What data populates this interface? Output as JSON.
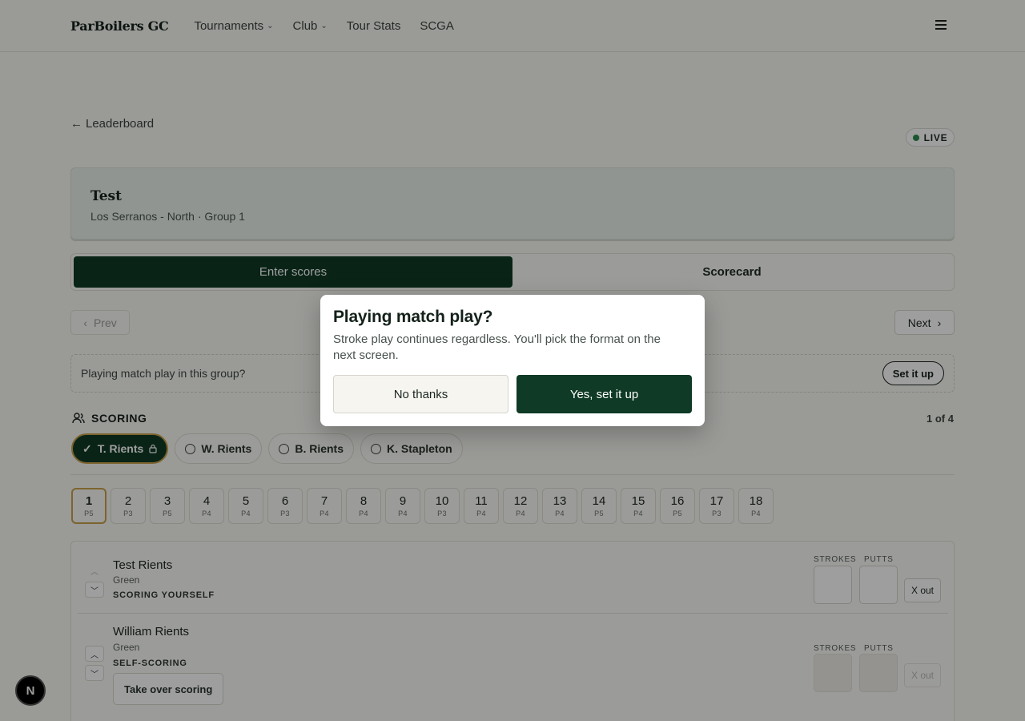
{
  "nav": {
    "brand": "ParBoilers GC",
    "links": [
      {
        "label": "Tournaments",
        "icon": "chevron-down-icon"
      },
      {
        "label": "Club",
        "icon": "chevron-down-icon"
      },
      {
        "label": "Tour Stats"
      },
      {
        "label": "SCGA"
      }
    ],
    "menu_icon": "hamburger-icon"
  },
  "back": {
    "label": "Leaderboard",
    "icon": "arrow-left-icon"
  },
  "live": {
    "label": "LIVE",
    "color": "#2b8c4f"
  },
  "event": {
    "title": "Test",
    "subtitle": "Los Serranos - North · Group 1"
  },
  "tabs": [
    {
      "label": "Enter scores",
      "active": true
    },
    {
      "label": "Scorecard",
      "active": false
    }
  ],
  "pager": {
    "prev": "Prev",
    "next": "Next"
  },
  "match_banner": {
    "text": "Playing match play in this group?",
    "button": "Set it up"
  },
  "scoring": {
    "title": "SCORING",
    "count": "1 of 4",
    "players": [
      {
        "label": "T. Rients",
        "active": true,
        "locked": true
      },
      {
        "label": "W. Rients",
        "active": false
      },
      {
        "label": "B. Rients",
        "active": false
      },
      {
        "label": "K. Stapleton",
        "active": false
      }
    ]
  },
  "holes": [
    {
      "num": "1",
      "par": "P5"
    },
    {
      "num": "2",
      "par": "P3"
    },
    {
      "num": "3",
      "par": "P5"
    },
    {
      "num": "4",
      "par": "P4"
    },
    {
      "num": "5",
      "par": "P4"
    },
    {
      "num": "6",
      "par": "P3"
    },
    {
      "num": "7",
      "par": "P4"
    },
    {
      "num": "8",
      "par": "P4"
    },
    {
      "num": "9",
      "par": "P4"
    },
    {
      "num": "10",
      "par": "P3"
    },
    {
      "num": "11",
      "par": "P4"
    },
    {
      "num": "12",
      "par": "P4"
    },
    {
      "num": "13",
      "par": "P4"
    },
    {
      "num": "14",
      "par": "P5"
    },
    {
      "num": "15",
      "par": "P4"
    },
    {
      "num": "16",
      "par": "P5"
    },
    {
      "num": "17",
      "par": "P3"
    },
    {
      "num": "18",
      "par": "P4"
    }
  ],
  "active_hole": 1,
  "rows": [
    {
      "name": "Test Rients",
      "tee": "Green",
      "status": "SCORING YOURSELF",
      "strokes_label": "STROKES",
      "putts_label": "PUTTS",
      "xout": "X out"
    },
    {
      "name": "William Rients",
      "tee": "Green",
      "status": "SELF-SCORING",
      "takeover": "Take over scoring",
      "strokes_label": "STROKES",
      "putts_label": "PUTTS",
      "xout": "X out"
    }
  ],
  "dev_badge": "N",
  "modal": {
    "title": "Playing match play?",
    "body": "Stroke play continues regardless. You'll pick the format on the next screen.",
    "secondary": "No thanks",
    "primary": "Yes, set it up"
  },
  "colors": {
    "primary": "#0f3a26",
    "accent": "#c9a24a",
    "page": "#f9f8f4"
  }
}
